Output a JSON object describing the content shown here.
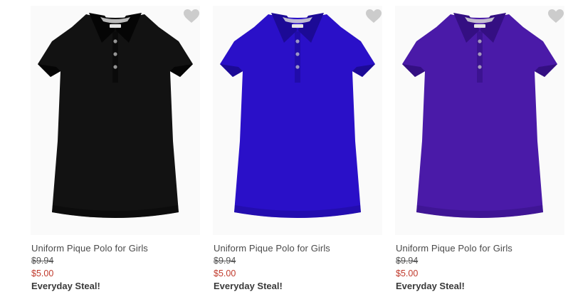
{
  "products": [
    {
      "title": "Uniform Pique Polo for Girls",
      "old_price": "$9.94",
      "sale_price": "$5.00",
      "badge": "Everyday Steal!",
      "color": "#121212",
      "shade": "#050505",
      "icon": "heart-icon"
    },
    {
      "title": "Uniform Pique Polo for Girls",
      "old_price": "$9.94",
      "sale_price": "$5.00",
      "badge": "Everyday Steal!",
      "color": "#2a10c8",
      "shade": "#1c0a96",
      "icon": "heart-icon"
    },
    {
      "title": "Uniform Pique Polo for Girls",
      "old_price": "$9.94",
      "sale_price": "$5.00",
      "badge": "Everyday Steal!",
      "color": "#4a1aa8",
      "shade": "#340f82",
      "icon": "heart-icon"
    }
  ],
  "colors": {
    "sale": "#c0392b",
    "heart": "#cccccc",
    "text": "#4a4a4a"
  }
}
